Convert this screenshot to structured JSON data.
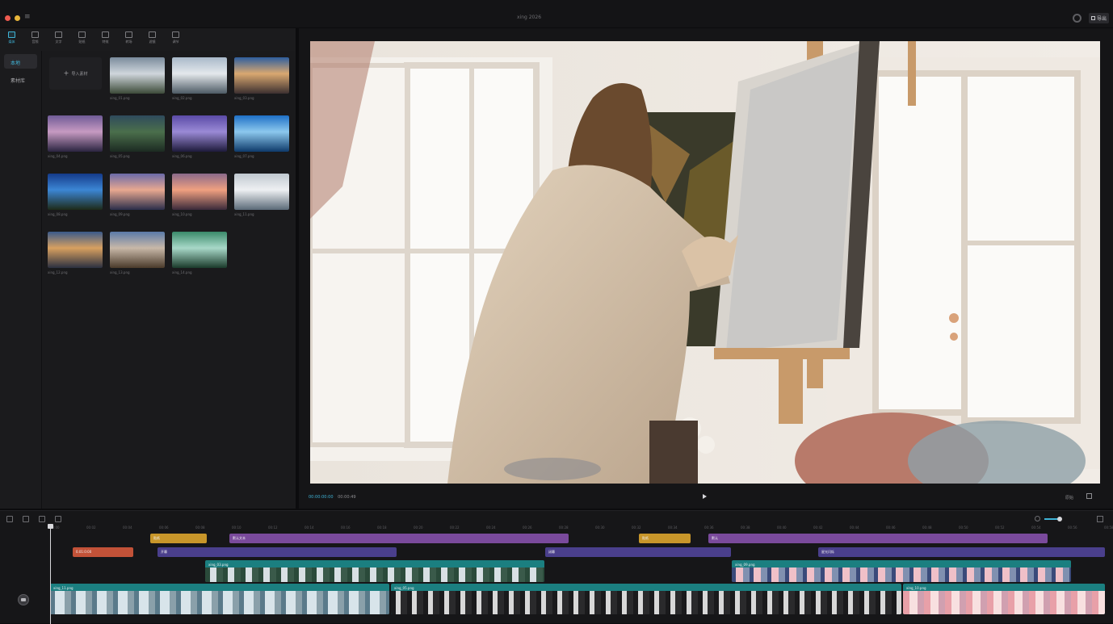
{
  "window": {
    "title": "xing 2026",
    "menu_icon": "≡",
    "export_label": "导出",
    "gear_icon": "gear-icon"
  },
  "toolbar": {
    "tools": [
      {
        "label": "媒体",
        "icon": "media-icon",
        "active": true
      },
      {
        "label": "音频",
        "icon": "audio-icon",
        "active": false
      },
      {
        "label": "文字",
        "icon": "text-icon",
        "active": false
      },
      {
        "label": "贴纸",
        "icon": "sticker-icon",
        "active": false
      },
      {
        "label": "特效",
        "icon": "effects-icon",
        "active": false
      },
      {
        "label": "转场",
        "icon": "transition-icon",
        "active": false
      },
      {
        "label": "滤镜",
        "icon": "filter-icon",
        "active": false
      },
      {
        "label": "调节",
        "icon": "adjust-icon",
        "active": false
      }
    ]
  },
  "sidebar": {
    "categories": [
      {
        "label": "本地",
        "active": true
      },
      {
        "label": "素材库",
        "active": false
      }
    ]
  },
  "media": {
    "import_label": "导入素材",
    "items": [
      {
        "label": "xing_01.png",
        "palette": [
          "#7a8b9c",
          "#cfd6dc",
          "#3c4a38"
        ]
      },
      {
        "label": "xing_02.png",
        "palette": [
          "#a9b9c9",
          "#e4e8ec",
          "#4c5a64"
        ]
      },
      {
        "label": "xing_03.png",
        "palette": [
          "#2e5e9e",
          "#d9a870",
          "#3c3030"
        ]
      },
      {
        "label": "xing_04.png",
        "palette": [
          "#6f5b96",
          "#c69ac2",
          "#2a2440"
        ]
      },
      {
        "label": "xing_05.png",
        "palette": [
          "#2e4a5c",
          "#4b6f4c",
          "#1c2a22"
        ]
      },
      {
        "label": "xing_06.png",
        "palette": [
          "#5a4aa6",
          "#9a8ad6",
          "#1e1a3a"
        ]
      },
      {
        "label": "xing_07.png",
        "palette": [
          "#1e70c6",
          "#8cc8ee",
          "#0e3a6a"
        ]
      },
      {
        "label": "xing_08.png",
        "palette": [
          "#143a8a",
          "#3c86d4",
          "#1e2a18"
        ]
      },
      {
        "label": "xing_09.png",
        "palette": [
          "#6a6aa8",
          "#e8a890",
          "#2a2e4a"
        ]
      },
      {
        "label": "xing_10.png",
        "palette": [
          "#8a6a8a",
          "#f0a080",
          "#3a2a3a"
        ]
      },
      {
        "label": "xing_11.png",
        "palette": [
          "#c0c8d0",
          "#eef0f2",
          "#5a6a78"
        ]
      },
      {
        "label": "xing_12.png",
        "palette": [
          "#3a5a8a",
          "#d8a060",
          "#2a3040"
        ]
      },
      {
        "label": "xing_13.png",
        "palette": [
          "#5a7aa8",
          "#c8b8a8",
          "#4a3a2a"
        ]
      },
      {
        "label": "xing_14.png",
        "palette": [
          "#3a8a6a",
          "#a8d8c8",
          "#1a3a2a"
        ]
      }
    ]
  },
  "player": {
    "current_time": "00:00:00:00",
    "duration": "00:00:49",
    "ratio": "原始",
    "play_icon": "play-icon",
    "fullscreen_icon": "fullscreen-icon"
  },
  "timeline": {
    "ruler_labels": [
      "00:00",
      "00:02",
      "00:04",
      "00:06",
      "00:08",
      "00:10",
      "00:12",
      "00:14",
      "00:16",
      "00:18",
      "00:20",
      "00:22",
      "00:24",
      "00:26",
      "00:28",
      "00:30",
      "00:32",
      "00:34",
      "00:36",
      "00:38",
      "00:40",
      "00:42",
      "00:44",
      "00:46",
      "00:48",
      "00:50",
      "00:52",
      "00:54",
      "00:56",
      "00:58"
    ],
    "tracks": {
      "stickers": [
        {
          "label": "贴纸",
          "color": "#c8962a"
        },
        {
          "label": "贴纸",
          "color": "#c8962a"
        }
      ],
      "titles": [
        {
          "label": "默认文本",
          "color": "#7a4a9c"
        },
        {
          "label": "默认",
          "color": "#7a4a9c"
        }
      ],
      "effects": [
        {
          "label": "0.01:0:00",
          "color": "#c25238"
        },
        {
          "label": "开幕",
          "color": "#4a3f8c"
        },
        {
          "label": "闭幕",
          "color": "#4a3f8c"
        },
        {
          "label": "星光闪烁",
          "color": "#4a3f8c"
        }
      ],
      "overlays": [
        {
          "label": "xing_03.png",
          "color": "#1b7f80"
        },
        {
          "label": "xing_09.png",
          "color": "#1b7f80"
        }
      ],
      "main": [
        {
          "label": "xing_11.png",
          "color": "#1b7f80"
        },
        {
          "label": "xing_05.png",
          "color": "#1b7f80"
        },
        {
          "label": "xing_10.png",
          "color": "#1b7f80"
        }
      ]
    }
  }
}
